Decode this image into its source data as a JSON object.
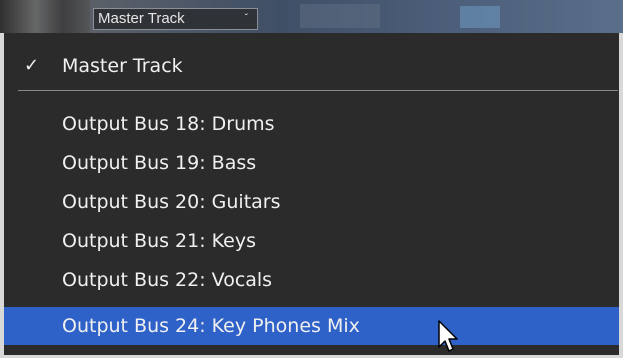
{
  "toolbar": {
    "selector_value": "Master Track",
    "caret_icon": "chevron-down-icon"
  },
  "menu": {
    "checked_item": {
      "label": "Master Track",
      "check_mark": "✓"
    },
    "items": [
      {
        "label": "Output Bus 18: Drums"
      },
      {
        "label": "Output Bus 19: Bass"
      },
      {
        "label": "Output Bus 20: Guitars"
      },
      {
        "label": "Output Bus 21: Keys"
      },
      {
        "label": "Output Bus 22: Vocals"
      },
      {
        "label": "Output Bus 24: Key Phones Mix"
      }
    ],
    "highlighted_index": 5
  },
  "colors": {
    "menu_background": "#2b2b2b",
    "highlight": "#2f62c9",
    "text": "#f0f0f0"
  }
}
